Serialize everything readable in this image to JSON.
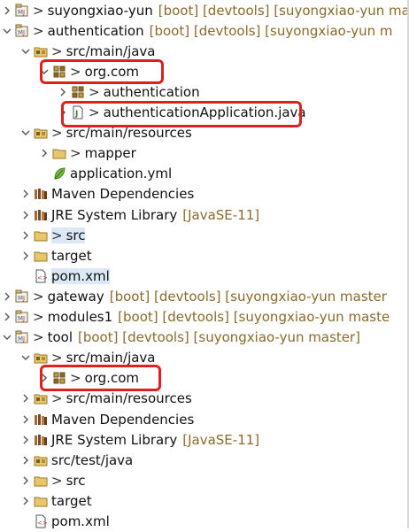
{
  "tree": [
    {
      "label": "suyongxiao-yun",
      "decoration": "[boot] [devtools] [suyongxiao-yun ma",
      "prefix": ">",
      "expanded": false,
      "icon": "project-icon",
      "depth": 0
    },
    {
      "label": "authentication",
      "decoration": "[boot] [devtools] [suyongxiao-yun m",
      "prefix": ">",
      "expanded": true,
      "icon": "project-icon",
      "depth": 0
    },
    {
      "label": "src/main/java",
      "decoration": "",
      "prefix": ">",
      "expanded": true,
      "icon": "source-folder-icon",
      "depth": 1
    },
    {
      "label": "org.com",
      "decoration": "",
      "prefix": ">",
      "expanded": true,
      "icon": "package-icon",
      "depth": 2
    },
    {
      "label": "authentication",
      "decoration": "",
      "prefix": ">",
      "expanded": false,
      "icon": "package-icon",
      "depth": 3
    },
    {
      "label": "authenticationApplication.java",
      "decoration": "",
      "prefix": ">",
      "expanded": false,
      "icon": "java-file-icon",
      "depth": 3
    },
    {
      "label": "src/main/resources",
      "decoration": "",
      "prefix": ">",
      "expanded": true,
      "icon": "source-folder-icon",
      "depth": 1
    },
    {
      "label": "mapper",
      "decoration": "",
      "prefix": ">",
      "expanded": false,
      "icon": "folder-icon",
      "depth": 2
    },
    {
      "label": "application.yml",
      "decoration": "",
      "prefix": "",
      "expanded": null,
      "icon": "yml-file-icon",
      "depth": 2
    },
    {
      "label": "Maven Dependencies",
      "decoration": "",
      "prefix": "",
      "expanded": false,
      "icon": "library-icon",
      "depth": 1
    },
    {
      "label": "JRE System Library",
      "decoration": "[JavaSE-11]",
      "prefix": "",
      "expanded": false,
      "icon": "library-icon",
      "depth": 1
    },
    {
      "label": "src",
      "decoration": "",
      "prefix": ">",
      "expanded": false,
      "icon": "folder-icon",
      "depth": 1,
      "selected": true
    },
    {
      "label": "target",
      "decoration": "",
      "prefix": "",
      "expanded": false,
      "icon": "folder-icon",
      "depth": 1
    },
    {
      "label": "pom.xml",
      "decoration": "",
      "prefix": "",
      "expanded": null,
      "icon": "xml-file-icon",
      "depth": 1,
      "selected": true
    },
    {
      "label": "gateway",
      "decoration": "[boot] [devtools] [suyongxiao-yun master",
      "prefix": ">",
      "expanded": false,
      "icon": "project-icon",
      "depth": 0
    },
    {
      "label": "modules1",
      "decoration": "[boot] [devtools] [suyongxiao-yun maste",
      "prefix": ">",
      "expanded": false,
      "icon": "project-icon",
      "depth": 0
    },
    {
      "label": "tool",
      "decoration": "[boot] [devtools] [suyongxiao-yun master]",
      "prefix": ">",
      "expanded": true,
      "icon": "project-icon",
      "depth": 0
    },
    {
      "label": "src/main/java",
      "decoration": "",
      "prefix": ">",
      "expanded": true,
      "icon": "source-folder-icon",
      "depth": 1
    },
    {
      "label": "org.com",
      "decoration": "",
      "prefix": ">",
      "expanded": false,
      "icon": "package-icon",
      "depth": 2
    },
    {
      "label": "src/main/resources",
      "decoration": "",
      "prefix": ">",
      "expanded": false,
      "icon": "source-folder-icon",
      "depth": 1
    },
    {
      "label": "Maven Dependencies",
      "decoration": "",
      "prefix": "",
      "expanded": false,
      "icon": "library-icon",
      "depth": 1
    },
    {
      "label": "JRE System Library",
      "decoration": "[JavaSE-11]",
      "prefix": "",
      "expanded": false,
      "icon": "library-icon",
      "depth": 1
    },
    {
      "label": "src/test/java",
      "decoration": "",
      "prefix": "",
      "expanded": false,
      "icon": "source-folder-icon",
      "depth": 1
    },
    {
      "label": "src",
      "decoration": "",
      "prefix": ">",
      "expanded": false,
      "icon": "folder-icon",
      "depth": 1
    },
    {
      "label": "target",
      "decoration": "",
      "prefix": "",
      "expanded": false,
      "icon": "folder-icon",
      "depth": 1
    },
    {
      "label": "pom.xml",
      "decoration": "",
      "prefix": "",
      "expanded": null,
      "icon": "xml-file-icon",
      "depth": 1
    }
  ],
  "colors": {
    "decoration": "#8b6a2b",
    "highlight_border": "#e02020",
    "selection": "#dbe9f7"
  }
}
